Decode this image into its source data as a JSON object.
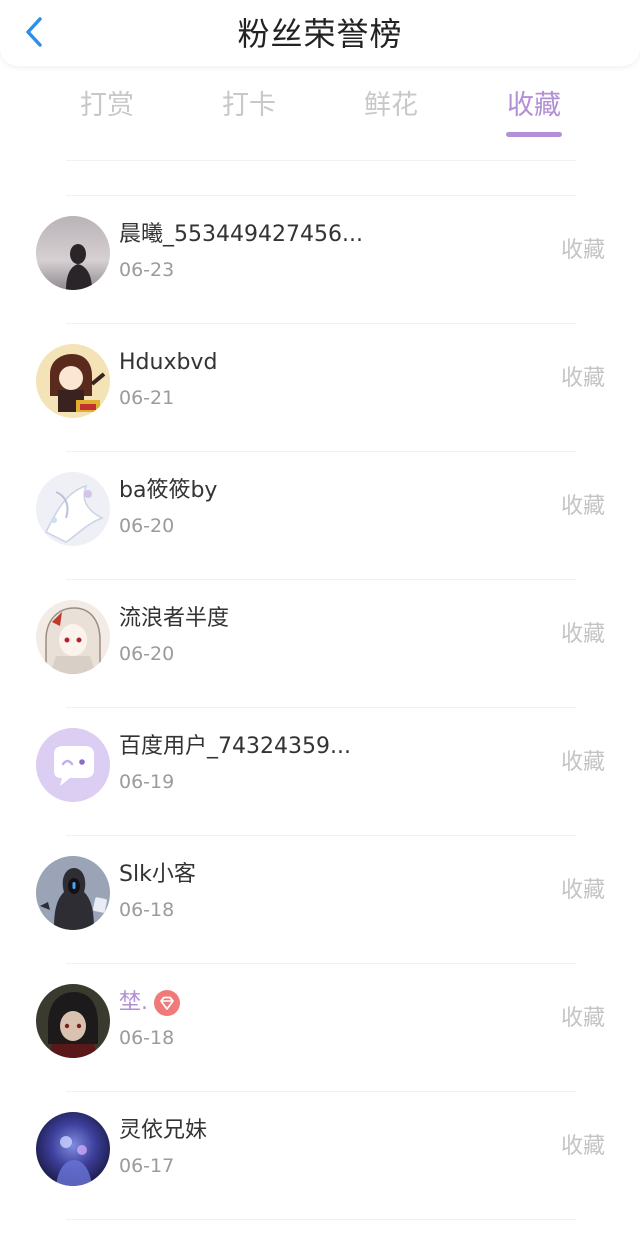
{
  "header": {
    "title": "粉丝荣誉榜",
    "back_icon": "chevron-left-icon"
  },
  "tabs": [
    {
      "label": "打赏",
      "active": false
    },
    {
      "label": "打卡",
      "active": false
    },
    {
      "label": "鲜花",
      "active": false
    },
    {
      "label": "收藏",
      "active": true
    }
  ],
  "colors": {
    "accent": "#b38fd6",
    "back_icon": "#2e8fe8",
    "badge": "#f07a7a"
  },
  "fans": [
    {
      "name": "晨曦_553449427456...",
      "date": "06-23",
      "action": "收藏",
      "avatar": "avatar-silhouette"
    },
    {
      "name": "Hduxbvd",
      "date": "06-21",
      "action": "收藏",
      "avatar": "avatar-cartoon-girl"
    },
    {
      "name": "ba筱筱by",
      "date": "06-20",
      "action": "收藏",
      "avatar": "avatar-white-dragon"
    },
    {
      "name": "流浪者半度",
      "date": "06-20",
      "action": "收藏",
      "avatar": "avatar-anime-girl"
    },
    {
      "name": "百度用户_74324359...",
      "date": "06-19",
      "action": "收藏",
      "avatar": "avatar-default-chat"
    },
    {
      "name": "Slk小客",
      "date": "06-18",
      "action": "收藏",
      "avatar": "avatar-hooded-figure"
    },
    {
      "name": "埜.",
      "date": "06-18",
      "action": "收藏",
      "avatar": "avatar-dark-anime",
      "vip": true,
      "badge_icon": "diamond-badge-icon"
    },
    {
      "name": "灵依兄妹",
      "date": "06-17",
      "action": "收藏",
      "avatar": "avatar-blue-night"
    }
  ]
}
